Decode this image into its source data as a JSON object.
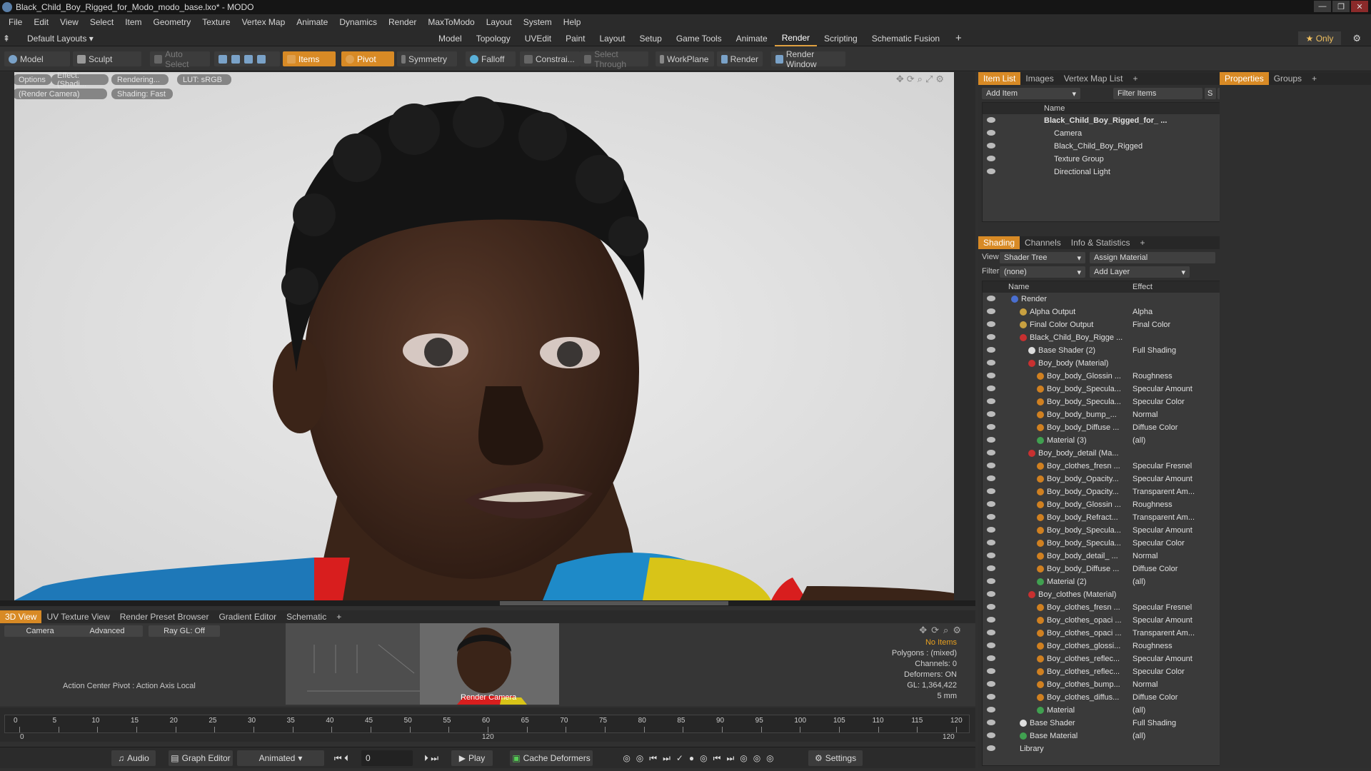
{
  "window": {
    "title": "Black_Child_Boy_Rigged_for_Modo_modo_base.lxo* - MODO",
    "min": "—",
    "max": "❐",
    "close": "✕"
  },
  "menu": [
    "File",
    "Edit",
    "View",
    "Select",
    "Item",
    "Geometry",
    "Texture",
    "Vertex Map",
    "Animate",
    "Dynamics",
    "Render",
    "MaxToModo",
    "Layout",
    "System",
    "Help"
  ],
  "layout_bar": {
    "layout_dropdown": "Default Layouts ▾",
    "tabs": [
      {
        "label": "Model",
        "active": false
      },
      {
        "label": "Topology",
        "active": false
      },
      {
        "label": "UVEdit",
        "active": false
      },
      {
        "label": "Paint",
        "active": false
      },
      {
        "label": "Layout",
        "active": false
      },
      {
        "label": "Setup",
        "active": false
      },
      {
        "label": "Game Tools",
        "active": false
      },
      {
        "label": "Animate",
        "active": false
      },
      {
        "label": "Render",
        "active": true
      },
      {
        "label": "Scripting",
        "active": false
      },
      {
        "label": "Schematic Fusion",
        "active": false
      }
    ],
    "add_tab": "+",
    "only": "★ Only"
  },
  "toolbar": {
    "model": "Model",
    "sculpt": "Sculpt",
    "auto_select": "Auto Select",
    "items": "Items",
    "pivot": "Pivot",
    "symmetry": "Symmetry",
    "falloff": "Falloff",
    "constraints": "Constrai...",
    "select_through": "Select Through",
    "workplane": "WorkPlane",
    "render": "Render",
    "render_window": "Render Window"
  },
  "viewport": {
    "options": "Options",
    "effect": "Effect: (Shadi...",
    "rendering": "Rendering...",
    "lut": "LUT: sRGB",
    "camera": "(Render Camera)",
    "shading": "Shading: Fast"
  },
  "bottom_tabs": [
    {
      "label": "3D View",
      "active": true
    },
    {
      "label": "UV Texture View",
      "active": false
    },
    {
      "label": "Render Preset Browser",
      "active": false
    },
    {
      "label": "Gradient Editor",
      "active": false
    },
    {
      "label": "Schematic",
      "active": false
    },
    {
      "label": "+",
      "active": false
    }
  ],
  "bottom_panel": {
    "camera_btn": "Camera",
    "advanced_btn": "Advanced",
    "raygl_btn": "Ray GL: Off",
    "action_center": "Action Center Pivot : Action Axis Local",
    "render_camera": "Render Camera",
    "info": {
      "no_items": "No Items",
      "polygons": "Polygons : (mixed)",
      "channels": "Channels: 0",
      "deformers": "Deformers: ON",
      "gl": "GL: 1,364,422",
      "unit": "5 mm"
    }
  },
  "timeline": {
    "ticks": [
      0,
      5,
      10,
      15,
      20,
      25,
      30,
      35,
      40,
      45,
      50,
      55,
      60,
      65,
      70,
      75,
      80,
      85,
      90,
      95,
      100,
      105,
      110,
      115,
      120
    ],
    "start": "0",
    "mid": "120",
    "end": "120"
  },
  "transport": {
    "audio": "Audio",
    "graph_editor": "Graph Editor",
    "animated": "Animated",
    "frame": "0",
    "play": "Play",
    "cache_deformers": "Cache Deformers",
    "settings": "Settings"
  },
  "item_list": {
    "tabs": [
      {
        "label": "Item List",
        "active": true
      },
      {
        "label": "Images",
        "active": false
      },
      {
        "label": "Vertex Map List",
        "active": false
      },
      {
        "label": "+",
        "active": false
      }
    ],
    "add_item": "Add Item",
    "filter_items": "Filter Items",
    "name_col": "Name",
    "items": [
      {
        "label": "Black_Child_Boy_Rigged_for_ ...",
        "indent": 0,
        "bold": true
      },
      {
        "label": "Camera",
        "indent": 1,
        "bold": false
      },
      {
        "label": "Black_Child_Boy_Rigged",
        "indent": 1,
        "bold": false
      },
      {
        "label": "Texture Group",
        "indent": 1,
        "bold": false
      },
      {
        "label": "Directional Light",
        "indent": 1,
        "bold": false
      }
    ]
  },
  "properties_tabs": [
    {
      "label": "Properties",
      "active": true
    },
    {
      "label": "Groups",
      "active": false
    },
    {
      "label": "+",
      "active": false
    }
  ],
  "shading": {
    "tabs": [
      {
        "label": "Shading",
        "active": true
      },
      {
        "label": "Channels",
        "active": false
      },
      {
        "label": "Info & Statistics",
        "active": false
      },
      {
        "label": "+",
        "active": false
      }
    ],
    "view_label": "View",
    "view_value": "Shader Tree",
    "assign_material": "Assign Material",
    "filter_label": "Filter",
    "filter_value": "(none)",
    "add_layer": "Add Layer",
    "name_col": "Name",
    "effect_col": "Effect",
    "rows": [
      {
        "name": "Render",
        "effect": "",
        "indent": 0,
        "color": "#4a6fd0"
      },
      {
        "name": "Alpha Output",
        "effect": "Alpha",
        "indent": 1,
        "color": "#c8a040"
      },
      {
        "name": "Final Color Output",
        "effect": "Final Color",
        "indent": 1,
        "color": "#c8a040"
      },
      {
        "name": "Black_Child_Boy_Rigge ...",
        "effect": "",
        "indent": 1,
        "color": "#c83030"
      },
      {
        "name": "Base Shader (2)",
        "effect": "Full Shading",
        "indent": 2,
        "color": "#dddddd"
      },
      {
        "name": "Boy_body (Material)",
        "effect": "",
        "indent": 2,
        "color": "#c83030"
      },
      {
        "name": "Boy_body_Glossin ...",
        "effect": "Roughness",
        "indent": 3,
        "color": "#d08020"
      },
      {
        "name": "Boy_body_Specula...",
        "effect": "Specular Amount",
        "indent": 3,
        "color": "#d08020"
      },
      {
        "name": "Boy_body_Specula...",
        "effect": "Specular Color",
        "indent": 3,
        "color": "#d08020"
      },
      {
        "name": "Boy_body_bump_...",
        "effect": "Normal",
        "indent": 3,
        "color": "#d08020"
      },
      {
        "name": "Boy_body_Diffuse ...",
        "effect": "Diffuse Color",
        "indent": 3,
        "color": "#d08020"
      },
      {
        "name": "Material (3)",
        "effect": "(all)",
        "indent": 3,
        "color": "#40a050"
      },
      {
        "name": "Boy_body_detail (Ma...",
        "effect": "",
        "indent": 2,
        "color": "#c83030"
      },
      {
        "name": "Boy_clothes_fresn ...",
        "effect": "Specular Fresnel",
        "indent": 3,
        "color": "#d08020"
      },
      {
        "name": "Boy_body_Opacity...",
        "effect": "Specular Amount",
        "indent": 3,
        "color": "#d08020"
      },
      {
        "name": "Boy_body_Opacity...",
        "effect": "Transparent Am...",
        "indent": 3,
        "color": "#d08020"
      },
      {
        "name": "Boy_body_Glossin ...",
        "effect": "Roughness",
        "indent": 3,
        "color": "#d08020"
      },
      {
        "name": "Boy_body_Refract...",
        "effect": "Transparent Am...",
        "indent": 3,
        "color": "#d08020"
      },
      {
        "name": "Boy_body_Specula...",
        "effect": "Specular Amount",
        "indent": 3,
        "color": "#d08020"
      },
      {
        "name": "Boy_body_Specula...",
        "effect": "Specular Color",
        "indent": 3,
        "color": "#d08020"
      },
      {
        "name": "Boy_body_detail_ ...",
        "effect": "Normal",
        "indent": 3,
        "color": "#d08020"
      },
      {
        "name": "Boy_body_Diffuse ...",
        "effect": "Diffuse Color",
        "indent": 3,
        "color": "#d08020"
      },
      {
        "name": "Material (2)",
        "effect": "(all)",
        "indent": 3,
        "color": "#40a050"
      },
      {
        "name": "Boy_clothes (Material)",
        "effect": "",
        "indent": 2,
        "color": "#c83030"
      },
      {
        "name": "Boy_clothes_fresn ...",
        "effect": "Specular Fresnel",
        "indent": 3,
        "color": "#d08020"
      },
      {
        "name": "Boy_clothes_opaci ...",
        "effect": "Specular Amount",
        "indent": 3,
        "color": "#d08020"
      },
      {
        "name": "Boy_clothes_opaci ...",
        "effect": "Transparent Am...",
        "indent": 3,
        "color": "#d08020"
      },
      {
        "name": "Boy_clothes_glossi...",
        "effect": "Roughness",
        "indent": 3,
        "color": "#d08020"
      },
      {
        "name": "Boy_clothes_reflec...",
        "effect": "Specular Amount",
        "indent": 3,
        "color": "#d08020"
      },
      {
        "name": "Boy_clothes_reflec...",
        "effect": "Specular Color",
        "indent": 3,
        "color": "#d08020"
      },
      {
        "name": "Boy_clothes_bump...",
        "effect": "Normal",
        "indent": 3,
        "color": "#d08020"
      },
      {
        "name": "Boy_clothes_diffus...",
        "effect": "Diffuse Color",
        "indent": 3,
        "color": "#d08020"
      },
      {
        "name": "Material",
        "effect": "(all)",
        "indent": 3,
        "color": "#40a050"
      },
      {
        "name": "Base Shader",
        "effect": "Full Shading",
        "indent": 1,
        "color": "#dddddd"
      },
      {
        "name": "Base Material",
        "effect": "(all)",
        "indent": 1,
        "color": "#40a050"
      },
      {
        "name": "Library",
        "effect": "",
        "indent": 1,
        "color": ""
      }
    ]
  }
}
